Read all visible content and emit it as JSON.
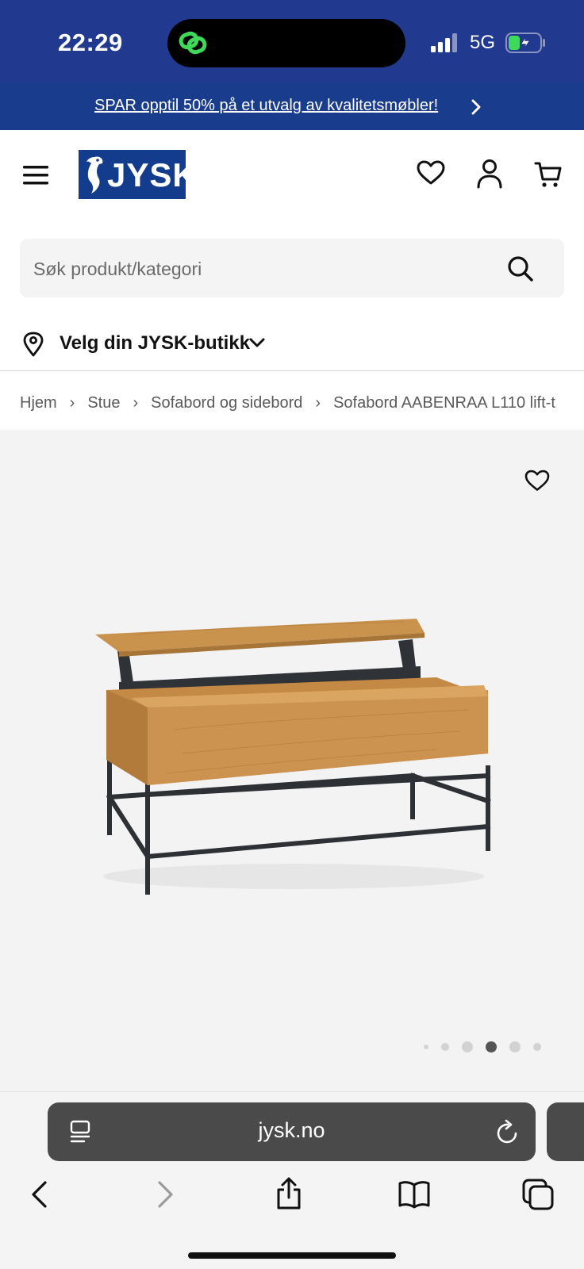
{
  "status": {
    "time": "22:29",
    "network": "5G",
    "icons": [
      "link-icon",
      "signal-icon",
      "battery-charging-icon"
    ]
  },
  "promo": {
    "text": "SPAR opptil 50% på et utvalg av kvalitetsmøbler!"
  },
  "header": {
    "logo_text": "JYSK",
    "icons": [
      "menu-icon",
      "heart-icon",
      "user-icon",
      "cart-icon"
    ]
  },
  "search": {
    "placeholder": "Søk produkt/kategori"
  },
  "store": {
    "label": "Velg din JYSK-butikk"
  },
  "breadcrumb": {
    "items": [
      "Hjem",
      "Stue",
      "Sofabord og sidebord",
      "Sofabord AABENRAA L110 lift-t"
    ]
  },
  "product": {
    "image_count": 6,
    "active_image_index": 3
  },
  "browser": {
    "url": "jysk.no"
  },
  "colors": {
    "brand_blue": "#143c8c",
    "status_bar": "#213a8f",
    "promo_bg": "#193c8d",
    "search_bg": "#f4f4f4",
    "product_bg": "#f3f3f3"
  }
}
